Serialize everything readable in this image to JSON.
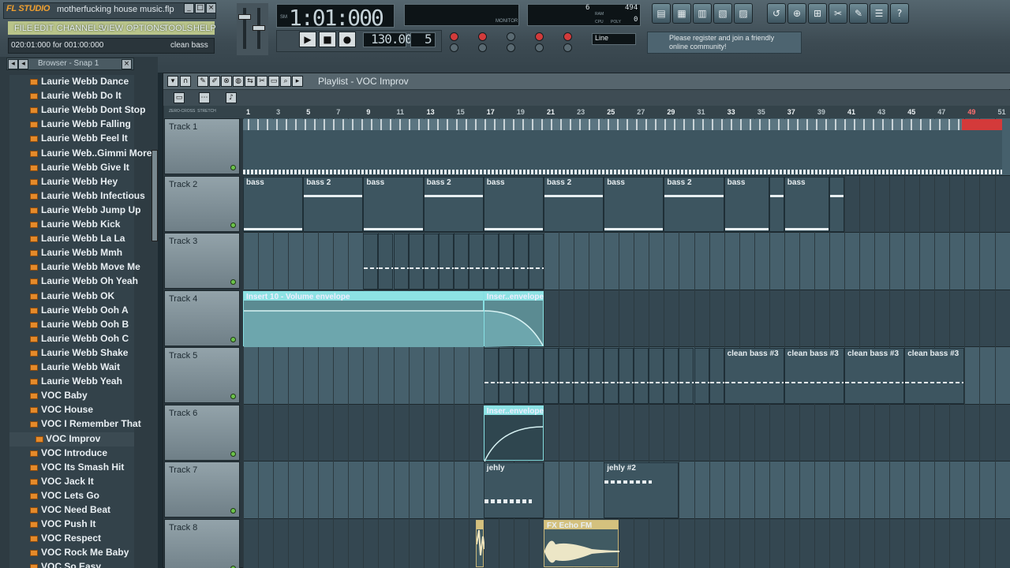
{
  "app": {
    "logo": "FL STUDIO",
    "project_name": "motherfucking house music.flp"
  },
  "menu": [
    "FILE",
    "EDIT",
    "CHANNELS",
    "VIEW",
    "OPTIONS",
    "TOOLS",
    "HELP"
  ],
  "hint": {
    "left": "020:01:000 for 001:00:000",
    "right": "clean bass"
  },
  "time_display": "1:01:000",
  "time_mode_label": "SM",
  "tempo": "130.000",
  "pattern": "5",
  "monitor_label": "MONITOR",
  "cpu": {
    "voices": "6",
    "ram_label": "RAM",
    "ram": "494",
    "cpu_label": "CPU",
    "poly_label": "POLY",
    "poly": "0"
  },
  "snap": "Line",
  "news": "Please register and join a friendly online community!",
  "browser": {
    "title": "Browser - Snap 1",
    "items": [
      "Laurie Webb Dance",
      "Laurie Webb Do It",
      "Laurie Webb Dont Stop",
      "Laurie Webb Falling",
      "Laurie Webb Feel It",
      "Laurie Web..Gimmi More",
      "Laurie Webb Give It",
      "Laurie Webb Hey",
      "Laurie Webb Infectious",
      "Laurie Webb Jump Up",
      "Laurie Webb Kick",
      "Laurie Webb La La",
      "Laurie Webb Mmh",
      "Laurie Webb Move Me",
      "Laurie Webb Oh Yeah",
      "Laurie Webb OK",
      "Laurie Webb Ooh A",
      "Laurie Webb Ooh B",
      "Laurie Webb Ooh C",
      "Laurie Webb Shake",
      "Laurie Webb Wait",
      "Laurie Webb Yeah",
      "VOC Baby",
      "VOC House",
      "VOC I Remember That",
      "VOC Improv",
      "VOC Introduce",
      "VOC Its Smash Hit",
      "VOC Jack It",
      "VOC Lets Go",
      "VOC Need Beat",
      "VOC Push It",
      "VOC Respect",
      "VOC Rock Me Baby",
      "VOC So Easy"
    ],
    "selected": "VOC Improv"
  },
  "playlist": {
    "title": "Playlist - VOC Improv",
    "ruler_labels": [
      "ZERO-CROSS",
      "STRETCH"
    ],
    "bars": [
      "1",
      "3",
      "5",
      "7",
      "9",
      "11",
      "13",
      "15",
      "17",
      "19",
      "21",
      "23",
      "25",
      "27",
      "29",
      "31",
      "33",
      "35",
      "37",
      "39",
      "41",
      "43",
      "45",
      "47",
      "49",
      "51"
    ],
    "tracks": [
      "Track 1",
      "Track 2",
      "Track 3",
      "Track 4",
      "Track 5",
      "Track 6",
      "Track 7",
      "Track 8"
    ],
    "clips": {
      "bass": "bass",
      "bass2": "bass 2",
      "env1": "Insert 10 - Volume envelope",
      "env2": "Inser..envelope",
      "cbass3": "clean bass #3",
      "jehly": "jehly",
      "jehly2": "jehly #2",
      "echo": "FX Echo FM"
    }
  },
  "icons": [
    "gear-icon",
    "play-icon",
    "stop-icon",
    "record-icon",
    "close-icon",
    "minimize-icon",
    "folder-icon"
  ]
}
